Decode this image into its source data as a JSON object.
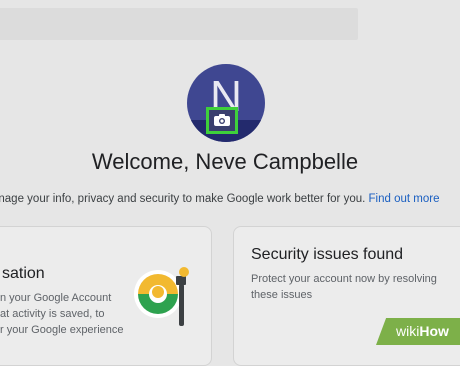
{
  "avatar": {
    "initial": "N"
  },
  "welcome": {
    "title": "Welcome, Neve Campbelle"
  },
  "intro": {
    "text": "anage your info, privacy and security to make Google work better for you.",
    "link": "Find out more"
  },
  "cards": {
    "privacy": {
      "title": "sation",
      "lines": [
        "n your Google Account",
        "at activity is saved, to",
        "r your Google experience"
      ]
    },
    "security": {
      "title": "Security issues found",
      "lines": [
        "Protect your account now by resolving",
        "these issues"
      ]
    }
  },
  "watermark": {
    "wiki": "wiki",
    "how": "How"
  },
  "colors": {
    "highlight": "#3ed03b",
    "avatar": "#3f4791",
    "link": "#1a5fc1"
  },
  "icons": {
    "camera": "camera-icon",
    "privacy": "privacy-illustration"
  }
}
